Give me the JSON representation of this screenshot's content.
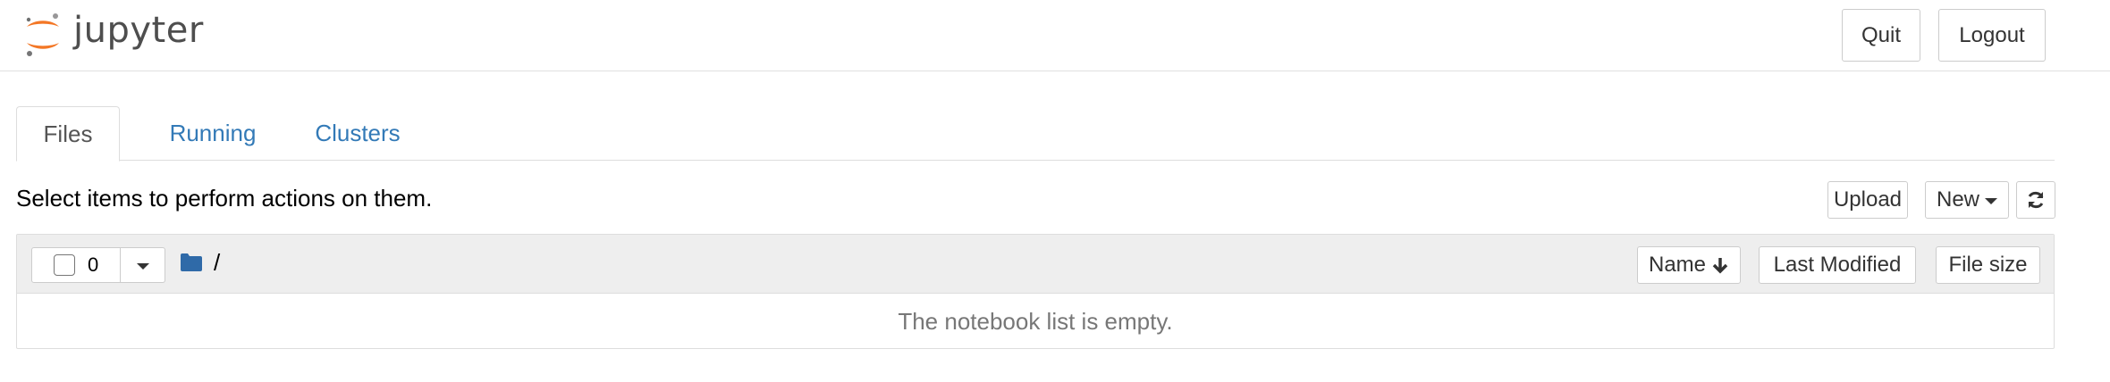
{
  "header": {
    "logo_text": "jupyter",
    "quit_label": "Quit",
    "logout_label": "Logout"
  },
  "tabs": [
    {
      "label": "Files",
      "active": true
    },
    {
      "label": "Running",
      "active": false
    },
    {
      "label": "Clusters",
      "active": false
    }
  ],
  "toolbar": {
    "instructions": "Select items to perform actions on them.",
    "upload_label": "Upload",
    "new_label": "New",
    "refresh_icon": "refresh-icon"
  },
  "file_list": {
    "selected_count": "0",
    "breadcrumb_path": "/",
    "columns": {
      "name": "Name",
      "last_modified": "Last Modified",
      "file_size": "File size"
    },
    "empty_message": "The notebook list is empty."
  },
  "colors": {
    "link": "#337ab7",
    "logo_orange": "#f37726",
    "logo_grey": "#767677",
    "folder_blue": "#2f6aa8"
  }
}
